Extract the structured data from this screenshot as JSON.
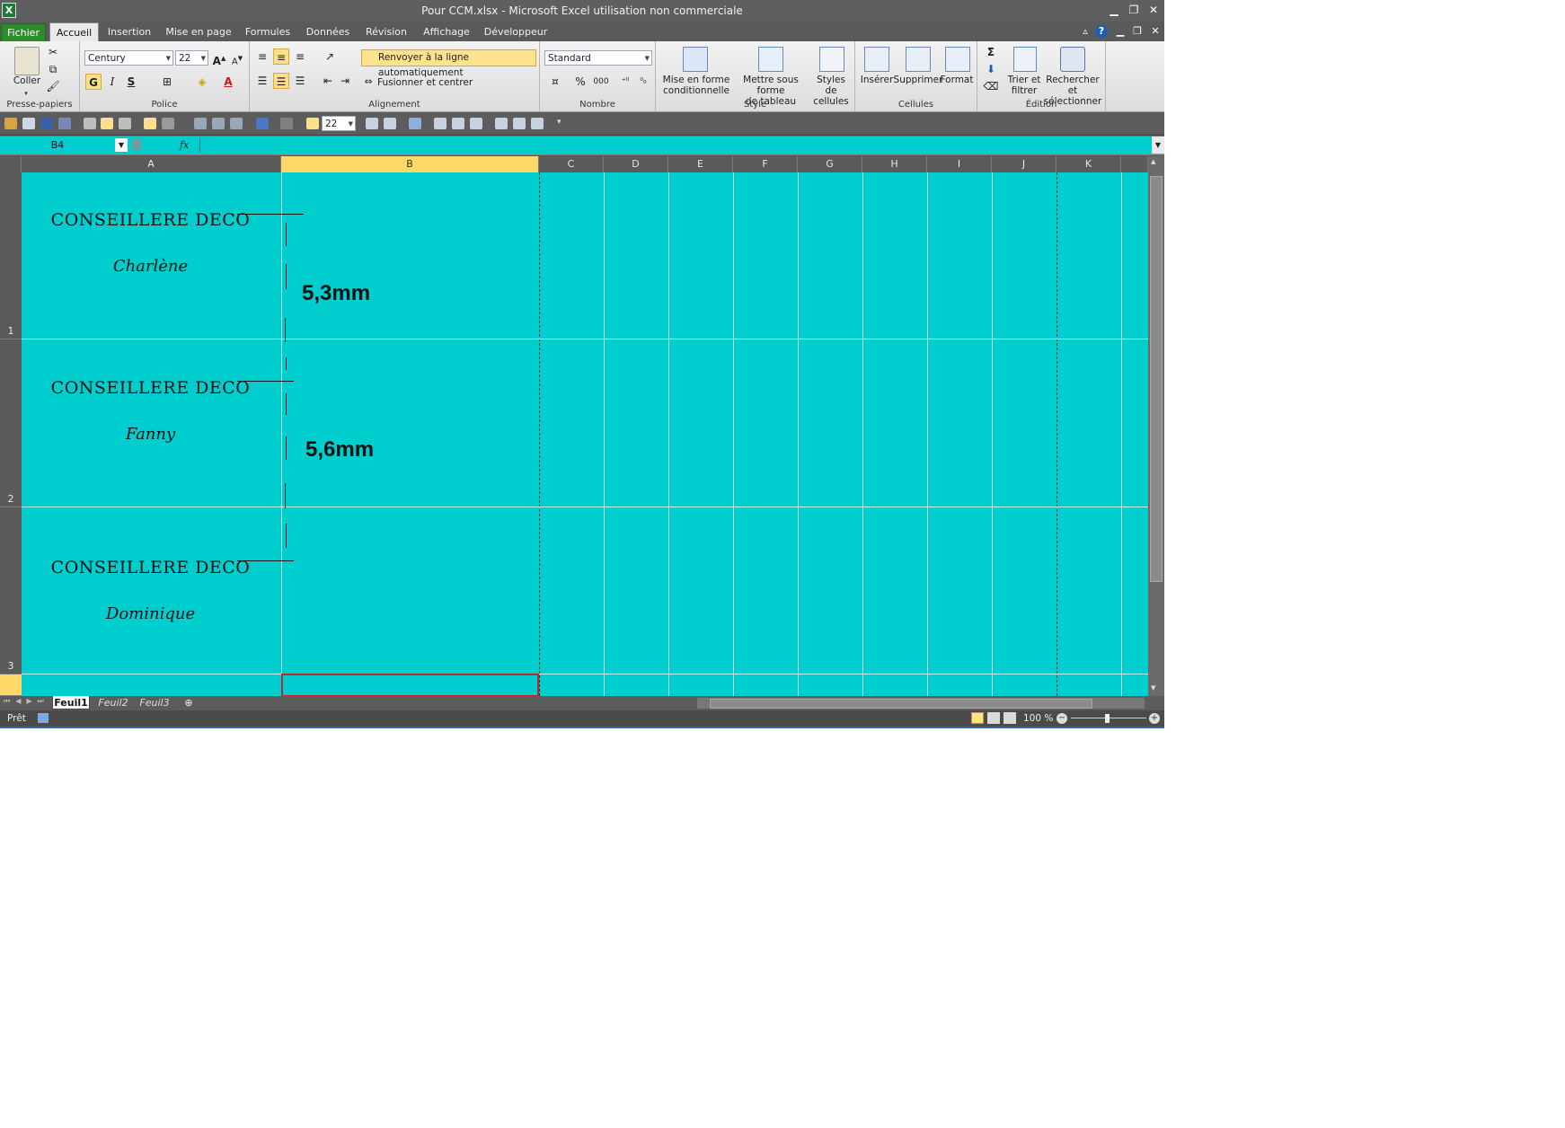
{
  "app": {
    "title": "Pour CCM.xlsx  -  Microsoft Excel utilisation non commerciale",
    "logo": "X"
  },
  "ribbon_tabs": [
    "Fichier",
    "Accueil",
    "Insertion",
    "Mise en page",
    "Formules",
    "Données",
    "Révision",
    "Affichage",
    "Développeur"
  ],
  "ribbon": {
    "clipboard": {
      "paste": "Coller",
      "label": "Presse-papiers"
    },
    "font": {
      "name": "Century",
      "size": "22",
      "bold": "G",
      "italic": "I",
      "strike": "S",
      "label": "Police"
    },
    "alignment": {
      "wrap": "Renvoyer à la ligne automatiquement",
      "merge": "Fusionner et centrer",
      "label": "Alignement"
    },
    "number": {
      "format": "Standard",
      "percent": "%",
      "thousands": "000",
      "label": "Nombre"
    },
    "style": {
      "cond_1": "Mise en forme",
      "cond_2": "conditionnelle",
      "table_1": "Mettre sous forme",
      "table_2": "de tableau",
      "cell_1": "Styles de",
      "cell_2": "cellules",
      "label": "Style"
    },
    "cells": {
      "insert": "Insérer",
      "delete": "Supprimer",
      "format": "Format",
      "label": "Cellules"
    },
    "editing": {
      "sigma": "Σ",
      "sort_1": "Trier et",
      "sort_2": "filtrer",
      "find_1": "Rechercher et",
      "find_2": "sélectionner",
      "label": "Édition"
    }
  },
  "quickbar": {
    "font_size": "22"
  },
  "formula_bar": {
    "namebox": "B4",
    "fx": "fx",
    "value": ""
  },
  "columns": [
    "A",
    "B",
    "C",
    "D",
    "E",
    "F",
    "G",
    "H",
    "I",
    "J",
    "K"
  ],
  "rows": [
    "1",
    "2",
    "3"
  ],
  "cells": {
    "A1_line1": "CONSEILLERE DECO",
    "A1_line2": "Charlène",
    "A2_line1": "CONSEILLERE DECO",
    "A2_line2": "Fanny",
    "A3_line1": "CONSEILLERE DECO",
    "A3_line2": "Dominique",
    "measure1": "5,3mm",
    "measure2": "5,6mm"
  },
  "sheet_tabs": [
    "Feuil1",
    "Feuil2",
    "Feuil3"
  ],
  "status": {
    "ready": "Prêt",
    "zoom": "100 %"
  },
  "colors": {
    "sheet_fill": "#00cdcd",
    "selected_header": "#ffd967",
    "active_cell_border": "#c0282c"
  }
}
